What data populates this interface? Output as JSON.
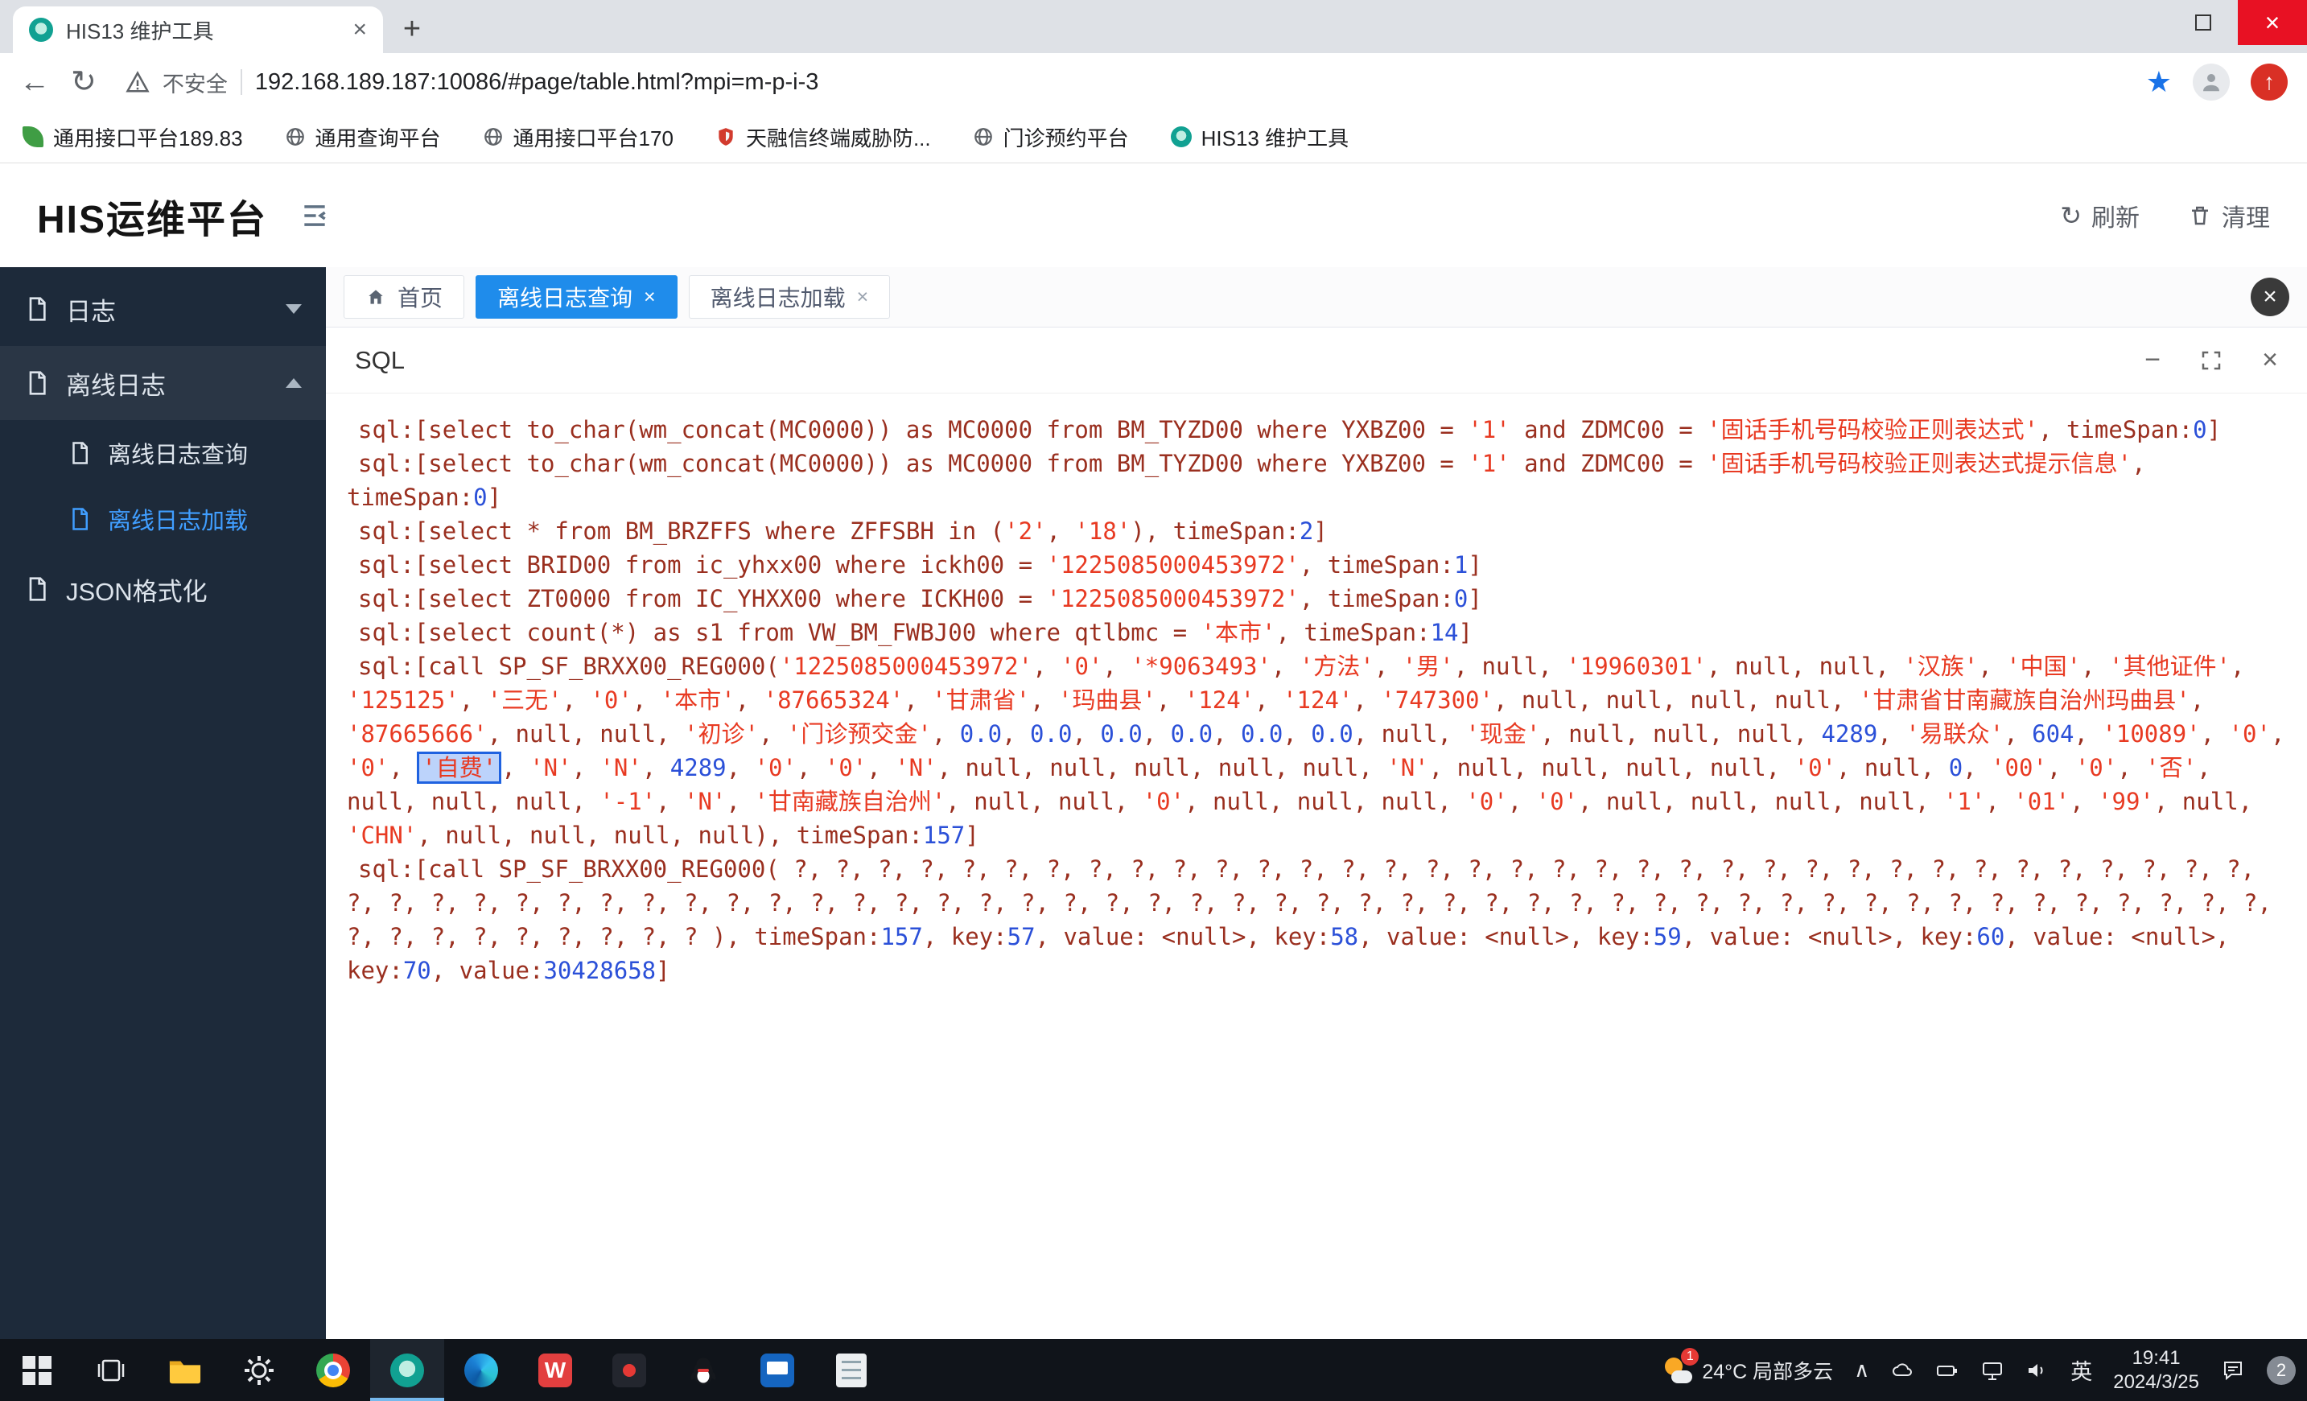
{
  "browser": {
    "tab_title": "HIS13 维护工具",
    "security_label": "不安全",
    "url": "192.168.189.187:10086/#page/table.html?mpi=m-p-i-3",
    "bookmarks": [
      {
        "label": "通用接口平台189.83"
      },
      {
        "label": "通用查询平台"
      },
      {
        "label": "通用接口平台170"
      },
      {
        "label": "天融信终端威胁防..."
      },
      {
        "label": "门诊预约平台"
      },
      {
        "label": "HIS13 维护工具"
      }
    ]
  },
  "app": {
    "title": "HIS运维平台",
    "refresh_label": "刷新",
    "clean_label": "清理",
    "sidebar": [
      {
        "label": "日志"
      },
      {
        "label": "离线日志"
      },
      {
        "label": "离线日志查询"
      },
      {
        "label": "离线日志加载"
      },
      {
        "label": "JSON格式化"
      }
    ],
    "tabs": [
      {
        "label": "首页"
      },
      {
        "label": "离线日志查询"
      },
      {
        "label": "离线日志加载"
      }
    ],
    "panel_title": "SQL"
  },
  "colors": {
    "accent_blue": "#1f8ceb",
    "sidebar_selected": "#409eff",
    "sql_base": "#9a2f1f",
    "sql_string": "#e83a22",
    "sql_number": "#2b50d8",
    "highlight_border": "#1f62e0",
    "window_close_red": "#e81123"
  },
  "sql_log": {
    "entries": [
      [
        {
          "c": "b",
          "t": "sql:[select to_char(wm_concat(MC0000)) as MC0000 from BM_TYZD00 where YXBZ00 = "
        },
        {
          "c": "s",
          "t": "'1'"
        },
        {
          "c": "b",
          "t": " and ZDMC00 = "
        },
        {
          "c": "s",
          "t": "'固话手机号码校验正则表达式'"
        },
        {
          "c": "b",
          "t": ", timeSpan:"
        },
        {
          "c": "n",
          "t": "0"
        },
        {
          "c": "b",
          "t": "]"
        }
      ],
      [
        {
          "c": "b",
          "t": "sql:[select to_char(wm_concat(MC0000)) as MC0000 from BM_TYZD00 where YXBZ00 = "
        },
        {
          "c": "s",
          "t": "'1'"
        },
        {
          "c": "b",
          "t": " and ZDMC00 = "
        },
        {
          "c": "s",
          "t": "'固话手机号码校验正则表达式提示信息'"
        },
        {
          "c": "b",
          "t": ", timeSpan:"
        },
        {
          "c": "n",
          "t": "0"
        },
        {
          "c": "b",
          "t": "]"
        }
      ],
      [
        {
          "c": "b",
          "t": "sql:[select * from BM_BRZFFS where ZFFSBH in ("
        },
        {
          "c": "s",
          "t": "'2'"
        },
        {
          "c": "b",
          "t": ", "
        },
        {
          "c": "s",
          "t": "'18'"
        },
        {
          "c": "b",
          "t": "), timeSpan:"
        },
        {
          "c": "n",
          "t": "2"
        },
        {
          "c": "b",
          "t": "]"
        }
      ],
      [
        {
          "c": "b",
          "t": "sql:[select BRID00 from ic_yhxx00 where ickh00 = "
        },
        {
          "c": "s",
          "t": "'1225085000453972'"
        },
        {
          "c": "b",
          "t": ", timeSpan:"
        },
        {
          "c": "n",
          "t": "1"
        },
        {
          "c": "b",
          "t": "]"
        }
      ],
      [
        {
          "c": "b",
          "t": "sql:[select ZT0000 from IC_YHXX00 where ICKH00 = "
        },
        {
          "c": "s",
          "t": "'1225085000453972'"
        },
        {
          "c": "b",
          "t": ", timeSpan:"
        },
        {
          "c": "n",
          "t": "0"
        },
        {
          "c": "b",
          "t": "]"
        }
      ],
      [
        {
          "c": "b",
          "t": "sql:[select count(*) as s1 from VW_BM_FWBJ00 where qtlbmc = "
        },
        {
          "c": "s",
          "t": "'本市'"
        },
        {
          "c": "b",
          "t": ", timeSpan:"
        },
        {
          "c": "n",
          "t": "14"
        },
        {
          "c": "b",
          "t": "]"
        }
      ],
      [
        {
          "c": "b",
          "t": "sql:[call SP_SF_BRXX00_REG000("
        },
        {
          "c": "s",
          "t": "'1225085000453972'"
        },
        {
          "c": "b",
          "t": ", "
        },
        {
          "c": "s",
          "t": "'0'"
        },
        {
          "c": "b",
          "t": ", "
        },
        {
          "c": "s",
          "t": "'*9063493'"
        },
        {
          "c": "b",
          "t": ", "
        },
        {
          "c": "s",
          "t": "'方法'"
        },
        {
          "c": "b",
          "t": ", "
        },
        {
          "c": "s",
          "t": "'男'"
        },
        {
          "c": "b",
          "t": ", null, "
        },
        {
          "c": "s",
          "t": "'19960301'"
        },
        {
          "c": "b",
          "t": ", null, null, "
        },
        {
          "c": "s",
          "t": "'汉族'"
        },
        {
          "c": "b",
          "t": ", "
        },
        {
          "c": "s",
          "t": "'中国'"
        },
        {
          "c": "b",
          "t": ", "
        },
        {
          "c": "s",
          "t": "'其他证件'"
        },
        {
          "c": "b",
          "t": ", "
        },
        {
          "c": "s",
          "t": "'125125'"
        },
        {
          "c": "b",
          "t": ", "
        },
        {
          "c": "s",
          "t": "'三无'"
        },
        {
          "c": "b",
          "t": ", "
        },
        {
          "c": "s",
          "t": "'0'"
        },
        {
          "c": "b",
          "t": ", "
        },
        {
          "c": "s",
          "t": "'本市'"
        },
        {
          "c": "b",
          "t": ", "
        },
        {
          "c": "s",
          "t": "'87665324'"
        },
        {
          "c": "b",
          "t": ", "
        },
        {
          "c": "s",
          "t": "'甘肃省'"
        },
        {
          "c": "b",
          "t": ", "
        },
        {
          "c": "s",
          "t": "'玛曲县'"
        },
        {
          "c": "b",
          "t": ", "
        },
        {
          "c": "s",
          "t": "'124'"
        },
        {
          "c": "b",
          "t": ", "
        },
        {
          "c": "s",
          "t": "'124'"
        },
        {
          "c": "b",
          "t": ", "
        },
        {
          "c": "s",
          "t": "'747300'"
        },
        {
          "c": "b",
          "t": ", null, null, null, null, "
        },
        {
          "c": "s",
          "t": "'甘肃省甘南藏族自治州玛曲县'"
        },
        {
          "c": "b",
          "t": ", "
        },
        {
          "c": "s",
          "t": "'87665666'"
        },
        {
          "c": "b",
          "t": ", null, null, "
        },
        {
          "c": "s",
          "t": "'初诊'"
        },
        {
          "c": "b",
          "t": ", "
        },
        {
          "c": "s",
          "t": "'门诊预交金'"
        },
        {
          "c": "b",
          "t": ", "
        },
        {
          "c": "n",
          "t": "0.0"
        },
        {
          "c": "b",
          "t": ", "
        },
        {
          "c": "n",
          "t": "0.0"
        },
        {
          "c": "b",
          "t": ", "
        },
        {
          "c": "n",
          "t": "0.0"
        },
        {
          "c": "b",
          "t": ", "
        },
        {
          "c": "n",
          "t": "0.0"
        },
        {
          "c": "b",
          "t": ", "
        },
        {
          "c": "n",
          "t": "0.0"
        },
        {
          "c": "b",
          "t": ", "
        },
        {
          "c": "n",
          "t": "0.0"
        },
        {
          "c": "b",
          "t": ", null, "
        },
        {
          "c": "s",
          "t": "'现金'"
        },
        {
          "c": "b",
          "t": ", null, null, null, "
        },
        {
          "c": "n",
          "t": "4289"
        },
        {
          "c": "b",
          "t": ", "
        },
        {
          "c": "s",
          "t": "'易联众'"
        },
        {
          "c": "b",
          "t": ", "
        },
        {
          "c": "n",
          "t": "604"
        },
        {
          "c": "b",
          "t": ", "
        },
        {
          "c": "s",
          "t": "'10089'"
        },
        {
          "c": "b",
          "t": ", "
        },
        {
          "c": "s",
          "t": "'0'"
        },
        {
          "c": "b",
          "t": ", "
        },
        {
          "c": "s",
          "t": "'0'"
        },
        {
          "c": "b",
          "t": ", "
        },
        {
          "c": "hl",
          "t": "'自费'"
        },
        {
          "c": "b",
          "t": ", "
        },
        {
          "c": "s",
          "t": "'N'"
        },
        {
          "c": "b",
          "t": ", "
        },
        {
          "c": "s",
          "t": "'N'"
        },
        {
          "c": "b",
          "t": ", "
        },
        {
          "c": "n",
          "t": "4289"
        },
        {
          "c": "b",
          "t": ", "
        },
        {
          "c": "s",
          "t": "'0'"
        },
        {
          "c": "b",
          "t": ", "
        },
        {
          "c": "s",
          "t": "'0'"
        },
        {
          "c": "b",
          "t": ", "
        },
        {
          "c": "s",
          "t": "'N'"
        },
        {
          "c": "b",
          "t": ", null, null, null, null, null, "
        },
        {
          "c": "s",
          "t": "'N'"
        },
        {
          "c": "b",
          "t": ", null, null, null, null, "
        },
        {
          "c": "s",
          "t": "'0'"
        },
        {
          "c": "b",
          "t": ", null, "
        },
        {
          "c": "n",
          "t": "0"
        },
        {
          "c": "b",
          "t": ", "
        },
        {
          "c": "s",
          "t": "'00'"
        },
        {
          "c": "b",
          "t": ", "
        },
        {
          "c": "s",
          "t": "'0'"
        },
        {
          "c": "b",
          "t": ", "
        },
        {
          "c": "s",
          "t": "'否'"
        },
        {
          "c": "b",
          "t": ", null, null, null, "
        },
        {
          "c": "s",
          "t": "'-1'"
        },
        {
          "c": "b",
          "t": ", "
        },
        {
          "c": "s",
          "t": "'N'"
        },
        {
          "c": "b",
          "t": ", "
        },
        {
          "c": "s",
          "t": "'甘南藏族自治州'"
        },
        {
          "c": "b",
          "t": ", null, null, "
        },
        {
          "c": "s",
          "t": "'0'"
        },
        {
          "c": "b",
          "t": ", null, null, null, "
        },
        {
          "c": "s",
          "t": "'0'"
        },
        {
          "c": "b",
          "t": ", "
        },
        {
          "c": "s",
          "t": "'0'"
        },
        {
          "c": "b",
          "t": ", null, null, null, null, "
        },
        {
          "c": "s",
          "t": "'1'"
        },
        {
          "c": "b",
          "t": ", "
        },
        {
          "c": "s",
          "t": "'01'"
        },
        {
          "c": "b",
          "t": ", "
        },
        {
          "c": "s",
          "t": "'99'"
        },
        {
          "c": "b",
          "t": ", null, "
        },
        {
          "c": "s",
          "t": "'CHN'"
        },
        {
          "c": "b",
          "t": ", null, null, null, null), timeSpan:"
        },
        {
          "c": "n",
          "t": "157"
        },
        {
          "c": "b",
          "t": "]"
        }
      ],
      [
        {
          "c": "b",
          "t": "sql:[call SP_SF_BRXX00_REG000( ?, ?, ?, ?, ?, ?, ?, ?, ?, ?, ?, ?, ?, ?, ?, ?, ?, ?, ?, ?, ?, ?, ?, ?, ?, ?, ?, ?, ?, ?, ?, ?, ?, ?, ?, ?, ?, ?, ?, ?, ?, ?, ?, ?, ?, ?, ?, ?, ?, ?, ?, ?, ?, ?, ?, ?, ?, ?, ?, ?, ?, ?, ?, ?, ?, ?, ?, ?, ?, ?, ?, ?, ?, ?, ?, ?, ?, ?, ?, ?, ?, ?, ?, ?, ?, ?, ?, ?, ?, ? ), timeSpan:"
        },
        {
          "c": "n",
          "t": "157"
        },
        {
          "c": "b",
          "t": ", key:"
        },
        {
          "c": "n",
          "t": "57"
        },
        {
          "c": "b",
          "t": ", value: <null>, key:"
        },
        {
          "c": "n",
          "t": "58"
        },
        {
          "c": "b",
          "t": ", value: <null>, key:"
        },
        {
          "c": "n",
          "t": "59"
        },
        {
          "c": "b",
          "t": ", value: <null>, key:"
        },
        {
          "c": "n",
          "t": "60"
        },
        {
          "c": "b",
          "t": ", value: <null>, key:"
        },
        {
          "c": "n",
          "t": "70"
        },
        {
          "c": "b",
          "t": ", value:"
        },
        {
          "c": "n",
          "t": "30428658"
        },
        {
          "c": "b",
          "t": "]"
        }
      ]
    ]
  },
  "taskbar": {
    "weather": "24°C 局部多云",
    "weather_badge": "1",
    "input_lang": "英",
    "time": "19:41",
    "date": "2024/3/25",
    "badge": "2"
  }
}
